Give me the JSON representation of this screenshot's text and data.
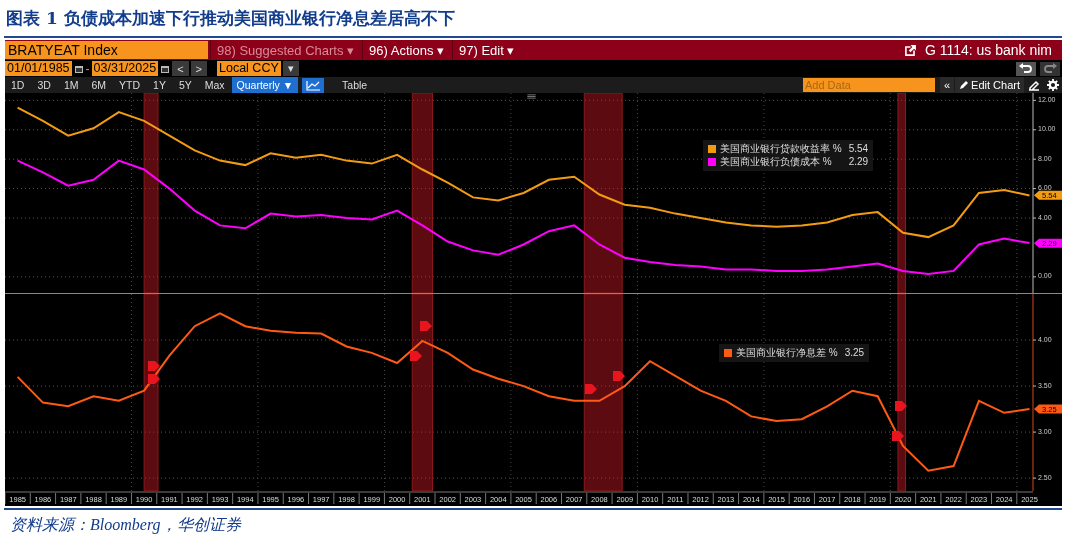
{
  "title": "图表 1 负债成本加速下行推动美国商业银行净息差居高不下",
  "terminal": {
    "top_bar": {
      "ticker": "BRATYEAT Index",
      "menus": [
        {
          "label": "98) Suggested Charts ▾",
          "disabled": true
        },
        {
          "label": "96) Actions ▾",
          "disabled": false
        },
        {
          "label": "97) Edit ▾",
          "disabled": false
        }
      ],
      "page_title": "G 1114: us bank nim"
    },
    "date_bar": {
      "start": "01/01/1985",
      "separator": "-",
      "end": "03/31/2025",
      "prev": "<",
      "next": ">",
      "currency": "Local CCY",
      "currency_caret": "▾"
    },
    "period_bar": {
      "periods": [
        {
          "label": "1D",
          "selected": false
        },
        {
          "label": "3D",
          "selected": false
        },
        {
          "label": "1M",
          "selected": false
        },
        {
          "label": "6M",
          "selected": false
        },
        {
          "label": "YTD",
          "selected": false
        },
        {
          "label": "1Y",
          "selected": false
        },
        {
          "label": "5Y",
          "selected": false
        },
        {
          "label": "Max",
          "selected": false
        }
      ],
      "frequency": {
        "label": "Quarterly ▼",
        "selected": true
      },
      "chart_view_selected": true,
      "table": {
        "label": "Table",
        "selected": false
      },
      "add_data": {
        "placeholder": "Add Data"
      },
      "collapse": "«",
      "edit_chart": "Edit Chart"
    },
    "charts": [
      {
        "legend_values": [
          "5.54",
          "2.29"
        ],
        "flag_labels": [
          "5.54",
          "2.29"
        ],
        "chart_data": {
          "type": "line",
          "grid": true,
          "legend": true,
          "ylim": [
            -1.1,
            12.5
          ],
          "yticks": [
            {
              "value": 0,
              "label": "0.00"
            },
            {
              "value": 4,
              "label": "4.00"
            },
            {
              "value": 6,
              "label": "6.00"
            },
            {
              "value": 8,
              "label": "8.00"
            },
            {
              "value": 10,
              "label": "10.00"
            },
            {
              "value": 12,
              "label": "12.00"
            }
          ],
          "series": [
            {
              "name": "美国商业银行贷款收益率 %",
              "color": "#f39c12",
              "values": [
                11.5,
                10.6,
                9.6,
                10.1,
                11.2,
                10.6,
                9.6,
                8.6,
                7.9,
                7.6,
                8.4,
                8.1,
                8.3,
                7.9,
                7.7,
                8.3,
                7.3,
                6.4,
                5.4,
                5.2,
                5.7,
                6.6,
                6.8,
                5.6,
                4.9,
                4.7,
                4.3,
                4.0,
                3.7,
                3.5,
                3.4,
                3.5,
                3.7,
                4.2,
                4.4,
                3.0,
                2.7,
                3.5,
                5.7,
                5.9,
                5.54
              ]
            },
            {
              "name": "美国商业银行负债成本 %",
              "color": "#ff00ff",
              "values": [
                7.9,
                7.1,
                6.2,
                6.6,
                7.9,
                7.3,
                6.0,
                4.5,
                3.5,
                3.3,
                4.3,
                4.1,
                4.2,
                4.0,
                3.9,
                4.5,
                3.5,
                2.4,
                1.8,
                1.5,
                2.2,
                3.1,
                3.5,
                2.2,
                1.3,
                1.0,
                0.8,
                0.7,
                0.5,
                0.5,
                0.4,
                0.4,
                0.5,
                0.7,
                0.9,
                0.4,
                0.2,
                0.4,
                2.2,
                2.6,
                2.29
              ]
            }
          ]
        }
      },
      {
        "legend_values": [
          "3.25"
        ],
        "flag_labels": [
          "3.25"
        ],
        "chart_data": {
          "type": "line",
          "grid": true,
          "legend": true,
          "xlim": [
            1984.5,
            2025.1
          ],
          "x": [
            1985,
            1986,
            1987,
            1988,
            1989,
            1990,
            1991,
            1992,
            1993,
            1994,
            1995,
            1996,
            1997,
            1998,
            1999,
            2000,
            2001,
            2002,
            2003,
            2004,
            2005,
            2006,
            2007,
            2008,
            2009,
            2010,
            2011,
            2012,
            2013,
            2014,
            2015,
            2016,
            2017,
            2018,
            2019,
            2020,
            2021,
            2022,
            2023,
            2024,
            2025
          ],
          "xticks": [
            1985,
            1986,
            1987,
            1988,
            1989,
            1990,
            1991,
            1992,
            1993,
            1994,
            1995,
            1996,
            1997,
            1998,
            1999,
            2000,
            2001,
            2002,
            2003,
            2004,
            2005,
            2006,
            2007,
            2008,
            2009,
            2010,
            2011,
            2012,
            2013,
            2014,
            2015,
            2016,
            2017,
            2018,
            2019,
            2020,
            2021,
            2022,
            2023,
            2024,
            2025
          ],
          "ylim": [
            2.36,
            4.5
          ],
          "yticks": [
            {
              "value": 2.5,
              "label": "2.50"
            },
            {
              "value": 3,
              "label": "3.00"
            },
            {
              "value": 3.5,
              "label": "3.50"
            },
            {
              "value": 4,
              "label": "4.00"
            }
          ],
          "series": [
            {
              "name": "美国商业银行净息差 %",
              "color": "#ff5a14",
              "values": [
                3.6,
                3.32,
                3.28,
                3.39,
                3.34,
                3.45,
                3.83,
                4.15,
                4.29,
                4.15,
                4.1,
                4.08,
                4.07,
                3.93,
                3.86,
                3.75,
                3.99,
                3.86,
                3.68,
                3.58,
                3.5,
                3.39,
                3.34,
                3.34,
                3.5,
                3.77,
                3.61,
                3.45,
                3.34,
                3.17,
                3.12,
                3.14,
                3.28,
                3.45,
                3.39,
                2.85,
                2.58,
                2.63,
                3.34,
                3.21,
                3.25
              ]
            }
          ],
          "bands": [
            {
              "axis": "x",
              "from": 1990,
              "to": 1990.55
            },
            {
              "axis": "x",
              "from": 2000.6,
              "to": 2001.4
            },
            {
              "axis": "x",
              "from": 2007.4,
              "to": 2008.9
            },
            {
              "axis": "x",
              "from": 2019.8,
              "to": 2020.1
            }
          ]
        }
      }
    ]
  },
  "source": "资料来源：Bloomberg，华创证券"
}
